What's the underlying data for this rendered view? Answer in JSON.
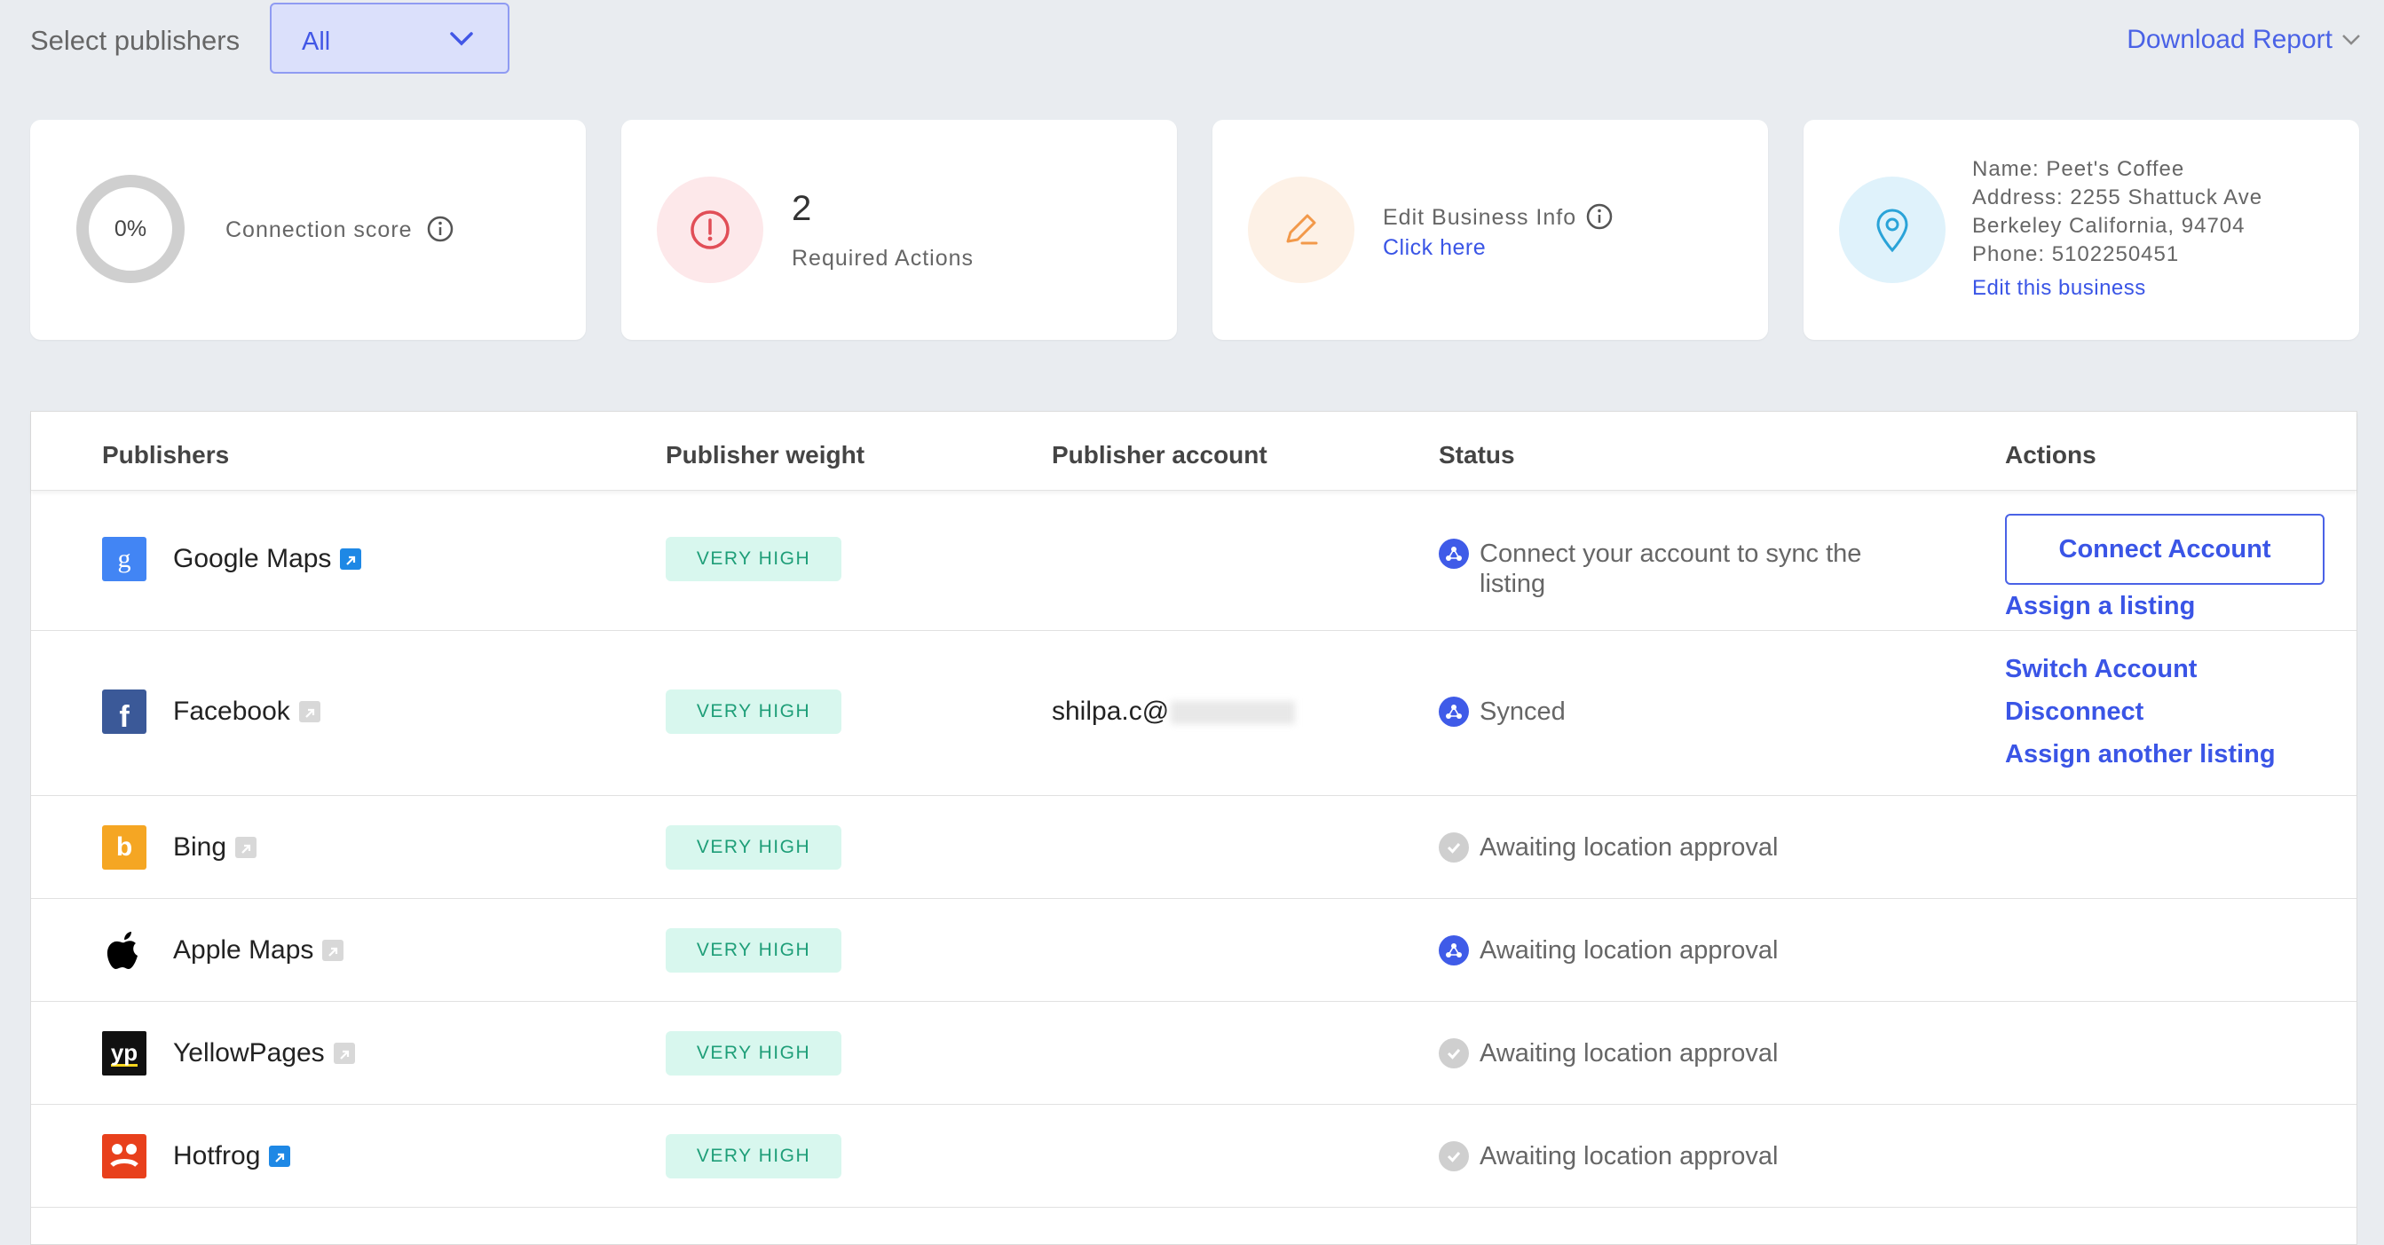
{
  "topbar": {
    "select_label": "Select publishers",
    "select_value": "All",
    "download": "Download Report"
  },
  "cards": {
    "score_value": "0%",
    "score_label": "Connection score",
    "required_count": "2",
    "required_label": "Required Actions",
    "edit_label": "Edit Business Info",
    "edit_link": "Click here",
    "business": {
      "name": "Name: Peet's Coffee",
      "address": "Address: 2255 Shattuck Ave",
      "city": "Berkeley California, 94704",
      "phone": "Phone: 5102250451",
      "edit_link": "Edit this business"
    }
  },
  "table": {
    "headers": [
      "Publishers",
      "Publisher weight",
      "Publisher account",
      "Status",
      "Actions"
    ],
    "rows": [
      {
        "name": "Google Maps",
        "weight": "VERY HIGH",
        "account": "",
        "status": "Connect your account to sync the listing",
        "status_icon": "sync-icon",
        "actions": [
          "Connect Account",
          "Assign a listing"
        ]
      },
      {
        "name": "Facebook",
        "weight": "VERY HIGH",
        "account": "shilpa.c@",
        "status": "Synced",
        "status_icon": "sync-icon",
        "actions": [
          "Switch Account",
          "Disconnect",
          "Assign another listing"
        ]
      },
      {
        "name": "Bing",
        "weight": "VERY HIGH",
        "account": "",
        "status": "Awaiting location approval",
        "status_icon": "check-icon",
        "actions": []
      },
      {
        "name": "Apple Maps",
        "weight": "VERY HIGH",
        "account": "",
        "status": "Awaiting location approval",
        "status_icon": "sync-icon",
        "actions": []
      },
      {
        "name": "YellowPages",
        "weight": "VERY HIGH",
        "account": "",
        "status": "Awaiting location approval",
        "status_icon": "check-icon",
        "actions": []
      },
      {
        "name": "Hotfrog",
        "weight": "VERY HIGH",
        "account": "",
        "status": "Awaiting location approval",
        "status_icon": "check-icon",
        "actions": []
      }
    ]
  },
  "colors": {
    "accent": "#3a55e6",
    "badge_bg": "#d8f7ee",
    "badge_text": "#1e9e78"
  }
}
